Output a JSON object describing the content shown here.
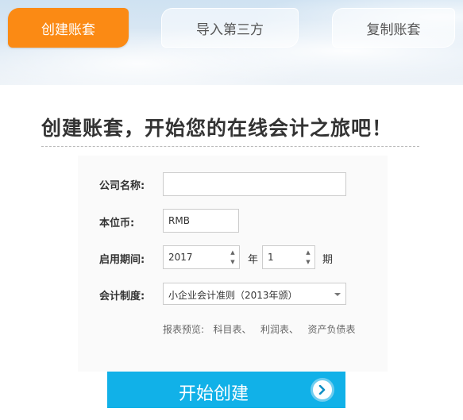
{
  "tabs": [
    {
      "label": "创建账套",
      "active": true
    },
    {
      "label": "导入第三方",
      "active": false
    },
    {
      "label": "复制账套",
      "active": false
    }
  ],
  "headline": "创建账套，开始您的在线会计之旅吧！",
  "form": {
    "company_name": {
      "label": "公司名称:",
      "value": ""
    },
    "currency": {
      "label": "本位币:",
      "value": "RMB"
    },
    "start_period": {
      "label": "启用期间:",
      "year_value": "2017",
      "year_unit": "年",
      "period_value": "1",
      "period_unit": "期"
    },
    "accounting_system": {
      "label": "会计制度:",
      "value": "小企业会计准则（2013年颁）"
    }
  },
  "report_preview": {
    "label": "报表预览:",
    "links": [
      "科目表、",
      "利润表、",
      "资产负债表"
    ]
  },
  "submit": {
    "label": "开始创建"
  },
  "colors": {
    "accent_orange": "#fb8a14",
    "button_blue": "#11b1e8"
  }
}
